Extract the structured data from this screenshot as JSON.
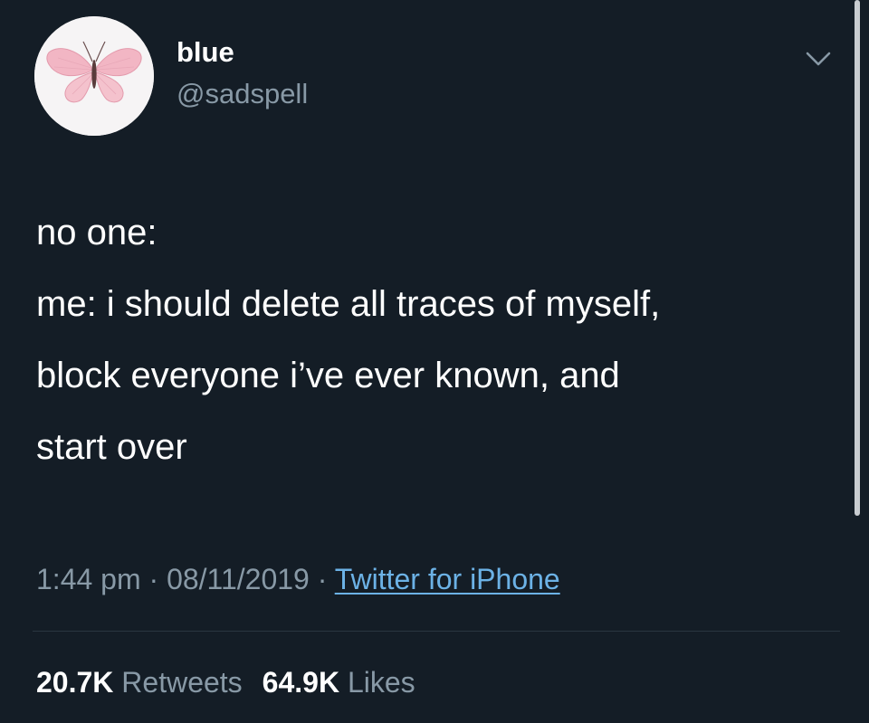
{
  "author": {
    "display_name": "blue",
    "handle": "@sadspell",
    "avatar_icon": "butterfly-icon"
  },
  "tweet": {
    "lines": [
      "no one:",
      "me: i should delete all traces of myself,",
      "block everyone i’ve ever known, and",
      "start over"
    ]
  },
  "meta": {
    "time": "1:44 pm",
    "separator": "·",
    "date": "08/11/2019",
    "source": "Twitter for iPhone"
  },
  "stats": {
    "retweets_count": "20.7K",
    "retweets_label": "Retweets",
    "likes_count": "64.9K",
    "likes_label": "Likes"
  },
  "colors": {
    "background": "#141d26",
    "text": "#ffffff",
    "secondary_text": "#8899a6",
    "link": "#6cb2e6"
  }
}
